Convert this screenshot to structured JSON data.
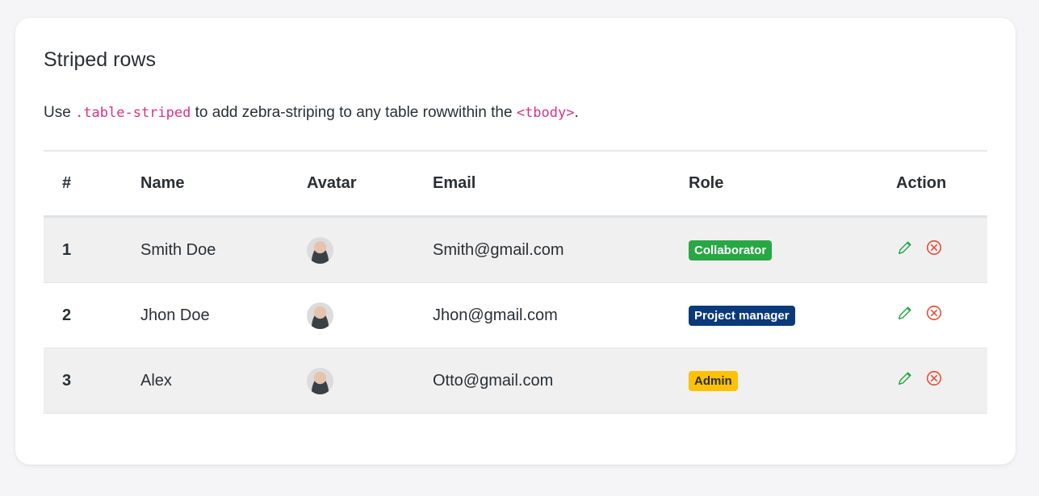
{
  "card": {
    "title": "Striped rows",
    "subtitle": {
      "prefix": "Use ",
      "code1": ".table-striped",
      "middle": " to add zebra-striping to any table rowwithin the ",
      "code2": "<tbody>",
      "suffix": "."
    }
  },
  "table": {
    "headers": [
      "#",
      "Name",
      "Avatar",
      "Email",
      "Role",
      "Action"
    ],
    "rows": [
      {
        "num": "1",
        "name": "Smith Doe",
        "email": "Smith@gmail.com",
        "role": "Collaborator",
        "role_color": "#28a745"
      },
      {
        "num": "2",
        "name": "Jhon Doe",
        "email": "Jhon@gmail.com",
        "role": "Project manager",
        "role_color": "#0b3a7a"
      },
      {
        "num": "3",
        "name": "Alex",
        "email": "Otto@gmail.com",
        "role": "Admin",
        "role_color": "#ffc107"
      }
    ]
  },
  "colors": {
    "code": "#d63384",
    "edit_icon": "#28a745",
    "delete_icon": "#e5533d",
    "stripe": "#f0f0f0"
  },
  "icons": {
    "edit": "pencil-icon",
    "delete": "circle-x-icon"
  }
}
